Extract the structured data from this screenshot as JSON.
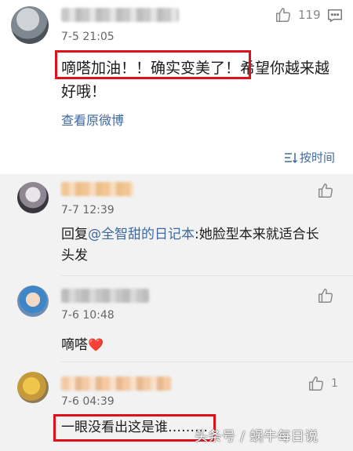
{
  "main_comment": {
    "time": "7-5 21:05",
    "likes": "119",
    "text": "嘀嗒加油！！确实变美了！希望你越来越好哦！",
    "view_original": "查看原微博"
  },
  "sort": {
    "label": "按时间"
  },
  "replies": [
    {
      "time": "7-7 12:39",
      "reply_prefix": "回复",
      "mention": "@全智甜的日记本",
      "text_after_mention": ":她脸型本来就适合长头发"
    },
    {
      "time": "7-6 10:48",
      "text": "嘀嗒",
      "emoji": "❤️"
    },
    {
      "time": "7-6 04:39",
      "likes": "1",
      "text": "一眼没看出这是谁………"
    }
  ],
  "watermark": "头条号 / 蜗牛每日说",
  "colors": {
    "link_blue": "#3d6aa1",
    "highlight_red": "#e0101a",
    "reply_bg": "#f2f2f2"
  },
  "icons": [
    "thumbs-up-icon",
    "comment-icon",
    "sort-icon"
  ]
}
